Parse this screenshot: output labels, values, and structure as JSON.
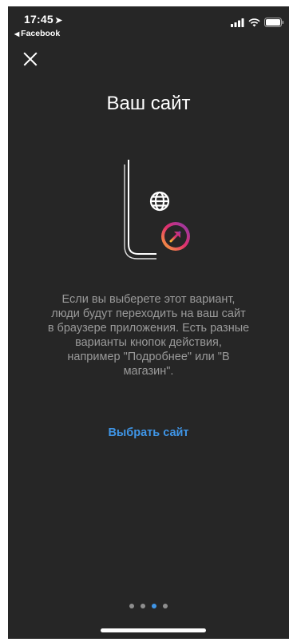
{
  "status_bar": {
    "time": "17:45",
    "location_icon": "location-arrow-icon",
    "back_app": "Facebook",
    "icons": [
      "signal-icon",
      "wifi-icon",
      "battery-icon"
    ]
  },
  "screen": {
    "close_icon": "close-icon",
    "title": "Ваш сайт",
    "description": "Если вы выберете этот вариант,\nлюди будут переходить на ваш сайт\nв браузере приложения. Есть разные\nварианты кнопок действия,\nнапример \"Подробнее\" или \"В\nмагазин\".",
    "select_site_label": "Выбрать сайт"
  },
  "pagination": {
    "total": 4,
    "active_index": 2
  },
  "colors": {
    "background": "#262626",
    "accent": "#3f95e6",
    "text_secondary": "#9a9a9a",
    "badge_gradient": [
      "#f9b233",
      "#e1306c",
      "#833ab4"
    ]
  }
}
